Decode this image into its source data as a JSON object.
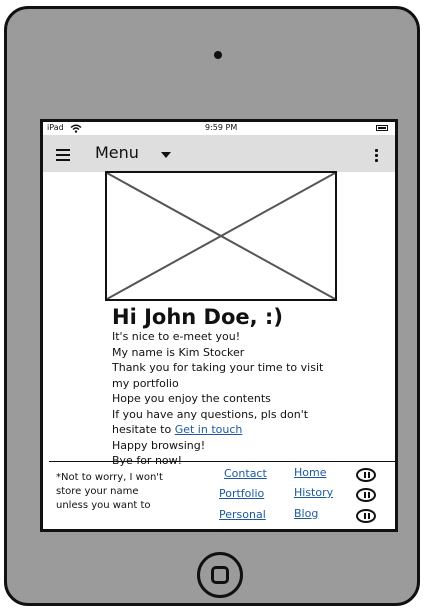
{
  "status": {
    "device": "iPad",
    "time": "9:59 PM"
  },
  "menubar": {
    "menu_label": "Menu"
  },
  "hero": {
    "image_icon": "image-placeholder-icon"
  },
  "greeting": "Hi John Doe, :)",
  "intro": {
    "line1": "It's nice to e-meet you!",
    "line2": "My name is Kim Stocker",
    "line3": "Thank you for taking your time to visit",
    "line4": "my portfolio",
    "line5": "Hope you enjoy the contents",
    "line6": "If you have any questions, pls don't",
    "line7_prefix": "hesitate to ",
    "line7_link": "Get in touch",
    "line8": "Happy browsing!",
    "line9": "Bye for now!"
  },
  "footer": {
    "note_line1": "*Not to worry, I won't",
    "note_line2": "store your name",
    "note_line3": "unless you want to",
    "links": {
      "contact": "Contact",
      "portfolio": "Portfolio",
      "personal": "Personal",
      "home": "Home",
      "history": "History",
      "blog": "Blog"
    }
  },
  "colors": {
    "device_frame": "#9b9b9b",
    "menubar_bg": "#dedede",
    "link": "#1c5a9e"
  }
}
